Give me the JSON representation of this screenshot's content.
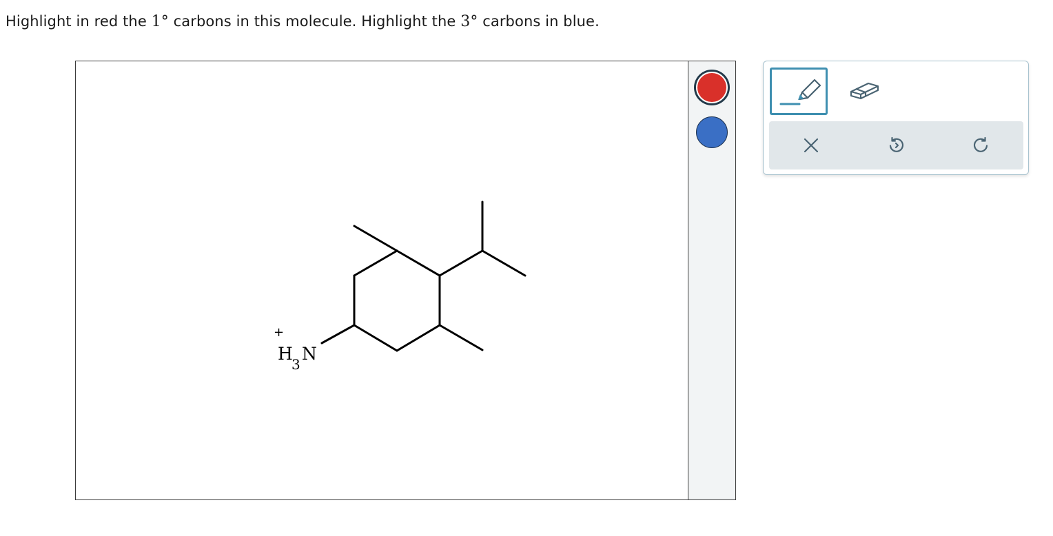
{
  "question": {
    "prefix": "Highlight in red the ",
    "primary_degree": "1°",
    "middle": " carbons in this molecule. Highlight the ",
    "tertiary_degree": "3°",
    "suffix": " carbons in blue."
  },
  "molecule": {
    "charge_label": "+",
    "amine_h": "H",
    "amine_subscript": "3",
    "amine_n": "N"
  },
  "colors": {
    "red_swatch": "#d9302a",
    "blue_swatch": "#3a6fc5",
    "panel_accent": "#3e8fb0",
    "icon_color": "#4a6473"
  },
  "tools": {
    "active": "highlighter",
    "items": [
      "highlighter-icon",
      "eraser-icon"
    ]
  },
  "actions": [
    "close-icon",
    "undo-icon",
    "redo-icon"
  ]
}
